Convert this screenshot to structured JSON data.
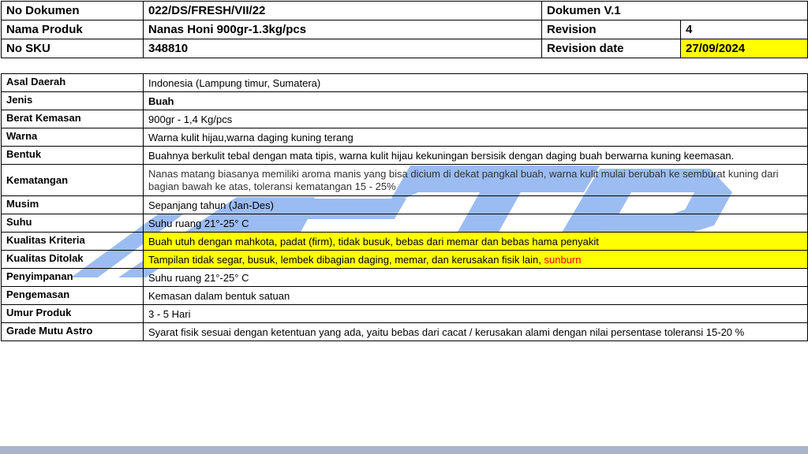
{
  "header": {
    "rows": [
      {
        "label": "No Dokumen",
        "value": "022/DS/FRESH/VII/22",
        "label2": "Dokumen V.1",
        "value2": ""
      },
      {
        "label": "Nama Produk",
        "value": "Nanas Honi 900gr-1.3kg/pcs",
        "label2": "Revision",
        "value2": "4"
      },
      {
        "label": "No SKU",
        "value": "348810",
        "label2": "Revision date",
        "value2": "27/09/2024"
      }
    ]
  },
  "spec": {
    "rows": [
      {
        "label": "Asal Daerah",
        "value": "Indonesia (Lampung timur, Sumatera)"
      },
      {
        "label": "Jenis",
        "value": "Buah"
      },
      {
        "label": "Berat Kemasan",
        "value": "900gr - 1,4 Kg/pcs"
      },
      {
        "label": "Warna",
        "value": "Warna kulit hijau,warna daging kuning terang"
      },
      {
        "label": "Bentuk",
        "value": "Buahnya berkulit tebal dengan mata tipis, warna kulit hijau kekuningan bersisik dengan daging buah berwarna kuning keemasan."
      },
      {
        "label": "Kematangan",
        "value": "Nanas matang biasanya memiliki aroma manis yang bisa dicium di dekat pangkal buah, warna kulit mulai berubah ke semburat kuning dari bagian bawah ke atas, toleransi kematangan 15 - 25%"
      },
      {
        "label": "Musim",
        "value": "Sepanjang tahun (Jan-Des)"
      },
      {
        "label": "Suhu",
        "value": "Suhu ruang 21°-25° C"
      },
      {
        "label": "Kualitas Kriteria",
        "value": "Buah utuh dengan mahkota, padat (firm), tidak busuk, bebas dari memar dan  bebas hama penyakit"
      },
      {
        "label": "Kualitas Ditolak",
        "value": "Tampilan tidak segar, busuk, lembek dibagian daging, memar, dan kerusakan fisik lain, ",
        "value_red": "sunburn"
      },
      {
        "label": "Penyimpanan",
        "value": "Suhu ruang 21°-25° C"
      },
      {
        "label": "Pengemasan",
        "value": "Kemasan dalam bentuk satuan"
      },
      {
        "label": "Umur Produk",
        "value": "3 - 5 Hari"
      },
      {
        "label": "Grade Mutu Astro",
        "value": "Syarat fisik sesuai dengan ketentuan yang ada, yaitu bebas dari cacat / kerusakan alami dengan  nilai persentase toleransi 15-20 %"
      }
    ]
  },
  "colors": {
    "highlight": "#ffff00",
    "warning_text": "#ff0000",
    "watermark": "#4a86e8"
  }
}
